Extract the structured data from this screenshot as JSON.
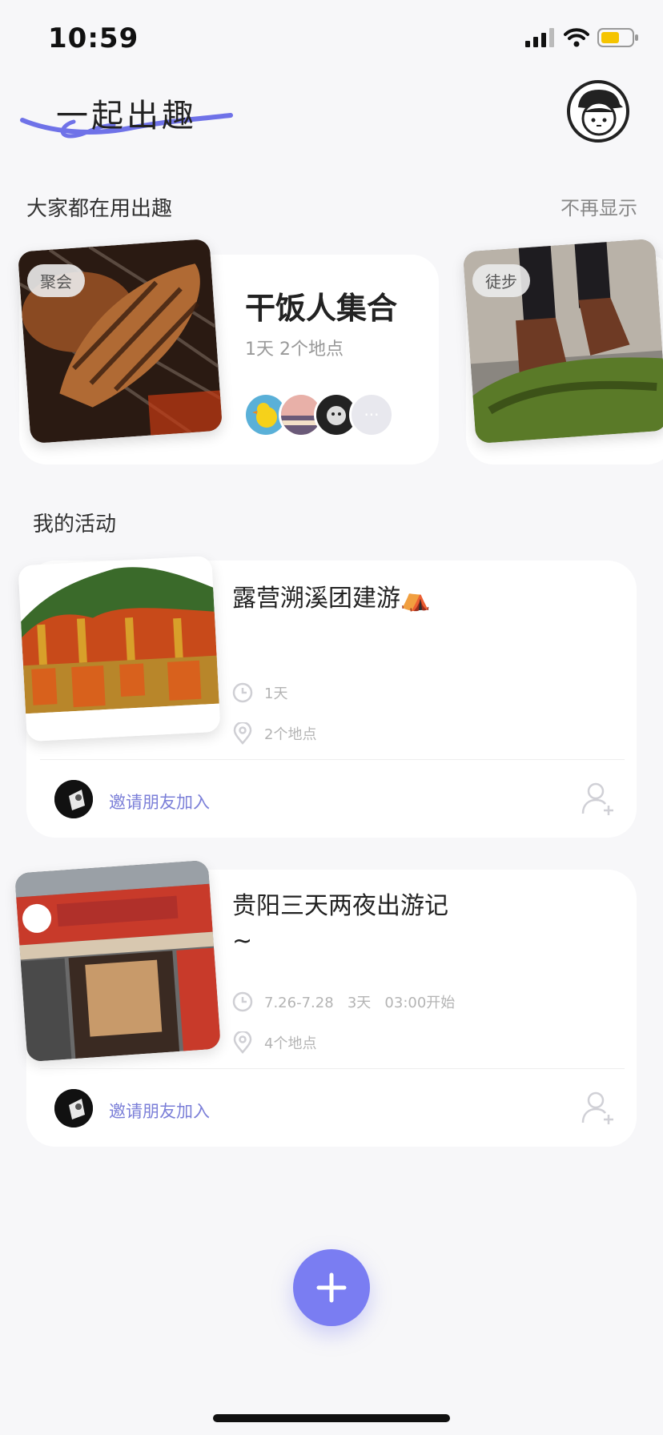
{
  "status_bar": {
    "time": "10:59"
  },
  "header": {
    "app_title": "一起出趣"
  },
  "templates": {
    "section_title": "大家都在用出趣",
    "dismiss_label": "不再显示",
    "items": [
      {
        "tag": "聚会",
        "name": "干饭人集合",
        "meta": "1天  2个地点"
      },
      {
        "tag": "徒步"
      }
    ]
  },
  "my_activities": {
    "section_title": "我的活动",
    "items": [
      {
        "title": "露营溯溪团建游⛺",
        "duration": "1天",
        "places": "2个地点",
        "invite_label": "邀请朋友加入"
      },
      {
        "title": "贵阳三天两夜出游记\n~",
        "duration": "7.26-7.28   3天   03:00开始",
        "places": "4个地点",
        "invite_label": "邀请朋友加入"
      }
    ]
  },
  "colors": {
    "accent": "#7a7df2",
    "invite_text": "#7b7fd8",
    "background": "#f7f7f9"
  },
  "icons": [
    "signal-icon",
    "wifi-icon",
    "battery-icon",
    "clock-icon",
    "location-pin-icon",
    "add-user-icon",
    "plus-icon"
  ]
}
